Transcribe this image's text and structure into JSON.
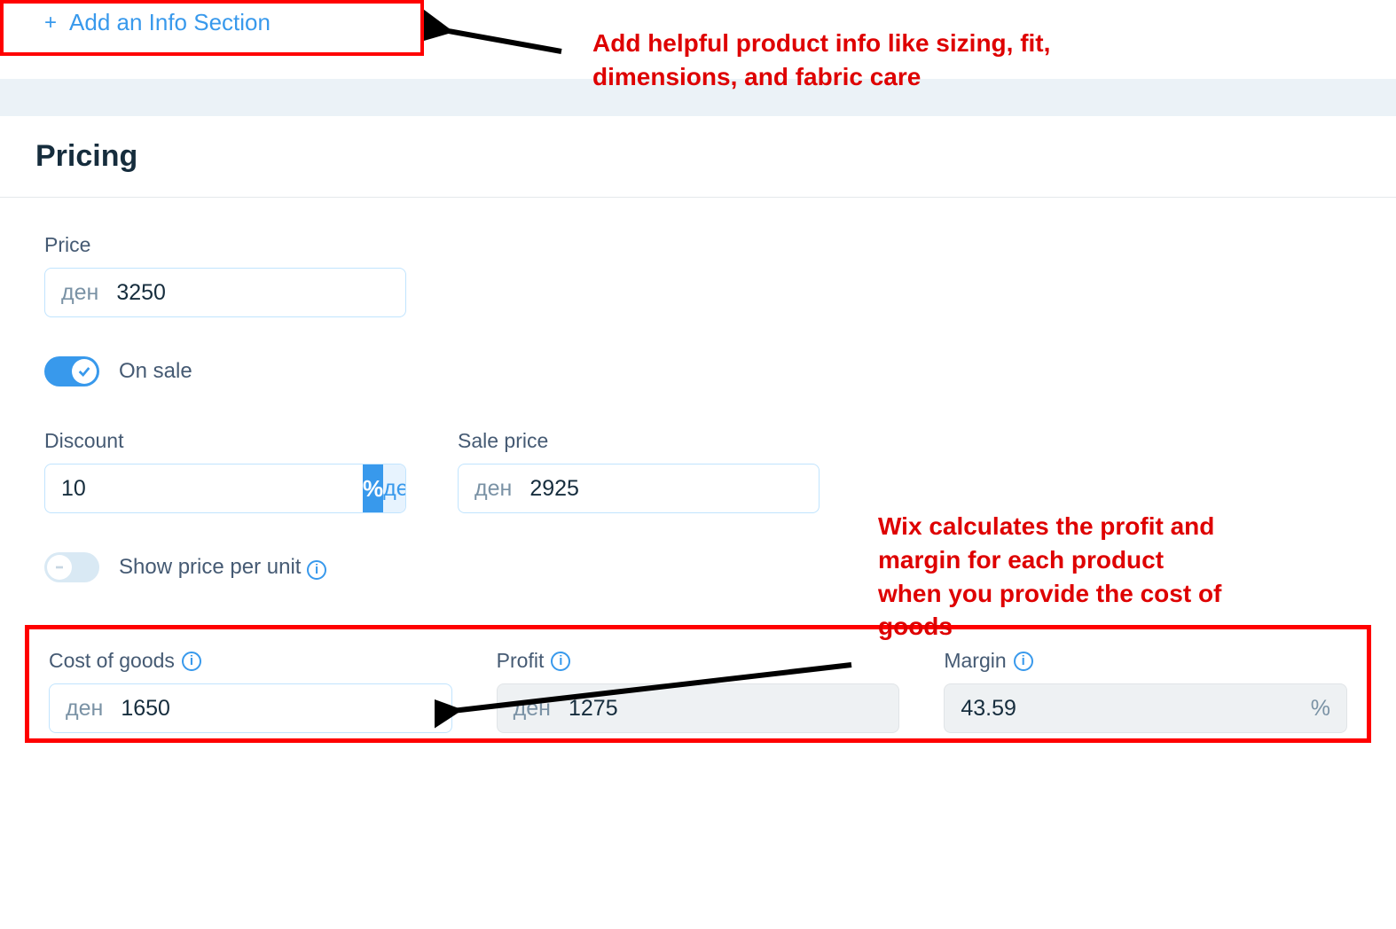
{
  "add_info_section": {
    "label": "Add an Info Section",
    "plus": "+"
  },
  "pricing": {
    "title": "Pricing",
    "price": {
      "label": "Price",
      "prefix": "ден",
      "value": "3250"
    },
    "on_sale": {
      "label": "On sale",
      "enabled": true
    },
    "discount": {
      "label": "Discount",
      "value": "10",
      "percent_label": "%",
      "unit_label": "ден"
    },
    "sale_price": {
      "label": "Sale price",
      "prefix": "ден",
      "value": "2925"
    },
    "show_ppu": {
      "label": "Show price per unit",
      "enabled": false
    },
    "cost_of_goods": {
      "label": "Cost of goods",
      "prefix": "ден",
      "value": "1650"
    },
    "profit": {
      "label": "Profit",
      "prefix": "ден",
      "value": "1275"
    },
    "margin": {
      "label": "Margin",
      "value": "43.59",
      "suffix": "%"
    }
  },
  "annotations": {
    "top": "Add helpful product info like sizing, fit, dimensions, and fabric care",
    "right": "Wix calculates the profit and margin for each product when you provide the cost of goods"
  }
}
